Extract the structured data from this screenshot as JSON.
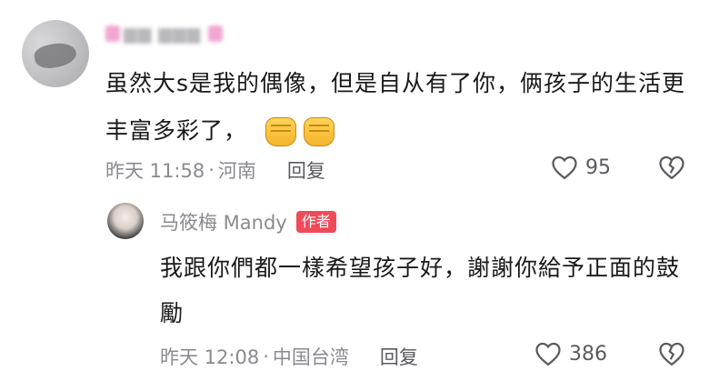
{
  "comment": {
    "username_obscured": "",
    "text": "虽然大s是我的偶像，但是自从有了你，俩孩子的生活更丰富多彩了，",
    "time": "昨天 11:58",
    "location": "河南",
    "reply_label": "回复",
    "likes": "95",
    "emojis": [
      "fist-emoji",
      "fist-emoji"
    ]
  },
  "reply": {
    "username": "马筱梅 Mandy",
    "badge": "作者",
    "text": "我跟你們都一樣希望孩子好，謝謝你給予正面的鼓勵",
    "time": "昨天 12:08",
    "location": "中国台湾",
    "reply_label": "回复",
    "likes": "386"
  },
  "colors": {
    "text": "#1a1a1a",
    "meta": "#8a8a8f",
    "badge_bg": "#f04a5a"
  }
}
